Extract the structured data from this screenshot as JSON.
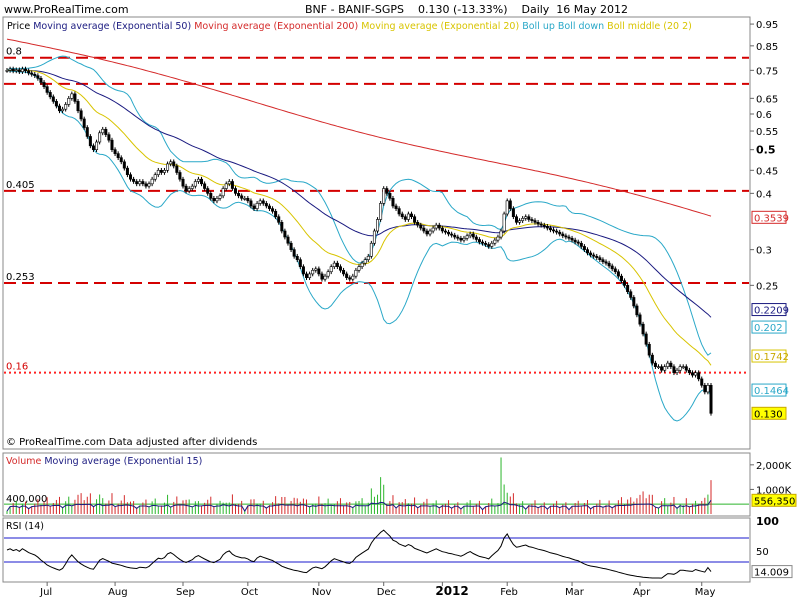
{
  "header": {
    "site": "www.ProRealTime.com",
    "title": "BNF - BANIF-SGPS    0.130 (-13.33%)    Daily  16 May 2012"
  },
  "price_panel": {
    "legend": [
      {
        "text": "Price",
        "color": "#000000"
      },
      {
        "text": "Moving average (Exponential 50)",
        "color": "#1a1a80"
      },
      {
        "text": "Moving average (Exponential 200)",
        "color": "#d42a2a"
      },
      {
        "text": "Moving average (Exponential 20)",
        "color": "#d8c400"
      },
      {
        "text": "Boll up Boll down",
        "color": "#2aa8c8"
      },
      {
        "text": "Boll middle (20 2)",
        "color": "#d8c400"
      }
    ],
    "footer": "© ProRealTime.com  Data adjusted after dividends",
    "axis_labels": [
      {
        "v": 0.95,
        "t": "0.95"
      },
      {
        "v": 0.85,
        "t": "0.85"
      },
      {
        "v": 0.75,
        "t": "0.75"
      },
      {
        "v": 0.65,
        "t": "0.65"
      },
      {
        "v": 0.6,
        "t": "0.6"
      },
      {
        "v": 0.55,
        "t": "0.55"
      },
      {
        "v": 0.5,
        "t": "0.5",
        "bold": true
      },
      {
        "v": 0.45,
        "t": "0.45"
      },
      {
        "v": 0.4,
        "t": "0.4"
      },
      {
        "v": 0.3,
        "t": "0.3"
      },
      {
        "v": 0.25,
        "t": "0.25"
      }
    ],
    "value_boxes": [
      {
        "v": 0.3539,
        "t": "0.3539",
        "border": "#d42a2a",
        "bg": "#ffffff",
        "fg": "#d42a2a"
      },
      {
        "v": 0.2209,
        "t": "0.2209",
        "border": "#1a1a80",
        "bg": "#ffffff",
        "fg": "#1a1a80"
      },
      {
        "v": 0.202,
        "t": "0.202",
        "border": "#2aa8c8",
        "bg": "#ffffff",
        "fg": "#2aa8c8"
      },
      {
        "v": 0.1742,
        "t": "0.1742",
        "border": "#d8c400",
        "bg": "#ffffff",
        "fg": "#c8a800"
      },
      {
        "v": 0.1464,
        "t": "0.1464",
        "border": "#2aa8c8",
        "bg": "#ffffff",
        "fg": "#2aa8c8"
      },
      {
        "v": 0.13,
        "t": "0.130",
        "border": "#c8a800",
        "bg": "#ffff00",
        "fg": "#000000"
      }
    ],
    "levels": [
      {
        "v": 0.8,
        "t": "0.8",
        "color": "#d40000"
      },
      {
        "v": 0.7,
        "t": "",
        "color": "#d40000"
      },
      {
        "v": 0.405,
        "t": "0.405",
        "color": "#d40000"
      },
      {
        "v": 0.253,
        "t": "0.253",
        "color": "#d40000"
      },
      {
        "v": 0.16,
        "t": "0.16",
        "color": "#ff2020"
      }
    ]
  },
  "volume_panel": {
    "legend": [
      {
        "text": "Volume",
        "color": "#d42a2a"
      },
      {
        "text": "Moving average (Exponential 15)",
        "color": "#1a1a80"
      }
    ],
    "axis_labels": [
      {
        "v": 2000000,
        "t": "2,000K"
      },
      {
        "v": 1000000,
        "t": "1,000K"
      }
    ],
    "threshold": {
      "v": 400000,
      "t": "400,000"
    },
    "value_box": {
      "v": 556350,
      "t": "556,350"
    }
  },
  "rsi_panel": {
    "legend": "RSI (14)",
    "axis_labels": [
      {
        "v": 100,
        "t": "100"
      },
      {
        "v": 50,
        "t": "50"
      }
    ],
    "value_box": {
      "v": 14.009,
      "t": "14.009"
    },
    "upper": 70,
    "lower": 30
  },
  "x_axis": {
    "labels": [
      {
        "i": 13,
        "t": "Jul"
      },
      {
        "i": 35,
        "t": "Aug"
      },
      {
        "i": 57,
        "t": "Sep"
      },
      {
        "i": 78,
        "t": "Oct"
      },
      {
        "i": 101,
        "t": "Nov"
      },
      {
        "i": 122,
        "t": "Dec"
      },
      {
        "i": 141,
        "t": "2012",
        "bold": true
      },
      {
        "i": 162,
        "t": "Feb"
      },
      {
        "i": 183,
        "t": "Mar"
      },
      {
        "i": 205,
        "t": "Apr"
      },
      {
        "i": 225,
        "t": "May"
      }
    ]
  },
  "chart_data": {
    "type": "candlestick",
    "title": "BNF - BANIF-SGPS",
    "ylim": [
      0.11,
      0.97
    ],
    "log_scale": true,
    "close": [
      0.75,
      0.755,
      0.748,
      0.752,
      0.745,
      0.755,
      0.748,
      0.74,
      0.735,
      0.73,
      0.72,
      0.705,
      0.69,
      0.67,
      0.655,
      0.64,
      0.625,
      0.61,
      0.615,
      0.63,
      0.65,
      0.665,
      0.64,
      0.61,
      0.585,
      0.56,
      0.535,
      0.51,
      0.5,
      0.52,
      0.545,
      0.555,
      0.54,
      0.525,
      0.5,
      0.49,
      0.48,
      0.47,
      0.455,
      0.44,
      0.43,
      0.425,
      0.42,
      0.425,
      0.42,
      0.415,
      0.42,
      0.43,
      0.44,
      0.45,
      0.445,
      0.45,
      0.465,
      0.47,
      0.46,
      0.445,
      0.43,
      0.415,
      0.405,
      0.41,
      0.415,
      0.425,
      0.43,
      0.42,
      0.41,
      0.4,
      0.39,
      0.385,
      0.39,
      0.395,
      0.41,
      0.42,
      0.425,
      0.41,
      0.4,
      0.395,
      0.39,
      0.39,
      0.385,
      0.375,
      0.37,
      0.38,
      0.385,
      0.38,
      0.375,
      0.37,
      0.365,
      0.355,
      0.345,
      0.33,
      0.32,
      0.31,
      0.3,
      0.29,
      0.285,
      0.275,
      0.265,
      0.26,
      0.265,
      0.27,
      0.272,
      0.265,
      0.258,
      0.262,
      0.268,
      0.275,
      0.28,
      0.275,
      0.27,
      0.265,
      0.26,
      0.258,
      0.262,
      0.27,
      0.275,
      0.28,
      0.285,
      0.29,
      0.31,
      0.33,
      0.35,
      0.38,
      0.41,
      0.4,
      0.39,
      0.375,
      0.37,
      0.36,
      0.355,
      0.35,
      0.36,
      0.355,
      0.345,
      0.34,
      0.335,
      0.33,
      0.325,
      0.33,
      0.335,
      0.34,
      0.335,
      0.33,
      0.328,
      0.325,
      0.323,
      0.32,
      0.318,
      0.315,
      0.318,
      0.322,
      0.325,
      0.32,
      0.316,
      0.312,
      0.31,
      0.308,
      0.305,
      0.31,
      0.315,
      0.32,
      0.33,
      0.36,
      0.385,
      0.37,
      0.355,
      0.345,
      0.348,
      0.352,
      0.355,
      0.35,
      0.348,
      0.345,
      0.342,
      0.34,
      0.338,
      0.335,
      0.332,
      0.33,
      0.328,
      0.325,
      0.322,
      0.32,
      0.318,
      0.315,
      0.312,
      0.31,
      0.305,
      0.3,
      0.295,
      0.292,
      0.29,
      0.288,
      0.285,
      0.282,
      0.28,
      0.276,
      0.272,
      0.268,
      0.262,
      0.256,
      0.25,
      0.242,
      0.235,
      0.225,
      0.215,
      0.205,
      0.195,
      0.185,
      0.175,
      0.168,
      0.165,
      0.165,
      0.162,
      0.165,
      0.168,
      0.165,
      0.16,
      0.162,
      0.165,
      0.165,
      0.162,
      0.16,
      0.158,
      0.16,
      0.155,
      0.15,
      0.145,
      0.15,
      0.13
    ],
    "rsi_last": 14.009,
    "volume_last": 556350
  }
}
